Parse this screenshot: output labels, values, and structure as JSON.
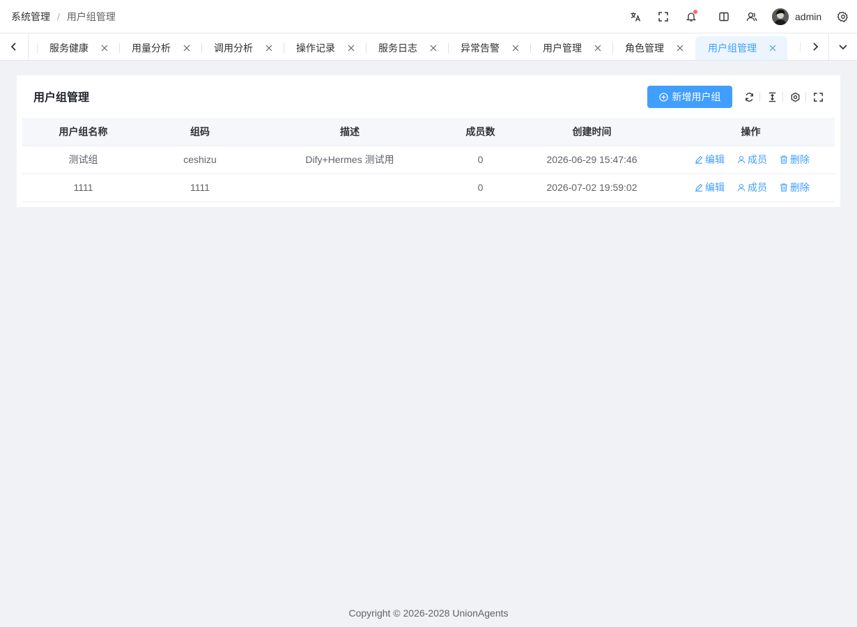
{
  "breadcrumb": {
    "parent": "系统管理",
    "separator": "/",
    "current": "用户组管理"
  },
  "header": {
    "icons": [
      "translate-icon",
      "fullscreen-icon",
      "bell-icon",
      "book-icon",
      "users-icon",
      "settings-icon"
    ],
    "notification_dot_color": "#f56c6c",
    "username": "admin"
  },
  "tabs": [
    {
      "label": "服务健康",
      "active": false
    },
    {
      "label": "用量分析",
      "active": false
    },
    {
      "label": "调用分析",
      "active": false
    },
    {
      "label": "操作记录",
      "active": false
    },
    {
      "label": "服务日志",
      "active": false
    },
    {
      "label": "异常告警",
      "active": false
    },
    {
      "label": "用户管理",
      "active": false
    },
    {
      "label": "角色管理",
      "active": false
    },
    {
      "label": "用户组管理",
      "active": true
    }
  ],
  "card": {
    "title": "用户组管理",
    "add_button": "新增用户组",
    "accent_color": "#409eff"
  },
  "table": {
    "columns": [
      "用户组名称",
      "组码",
      "描述",
      "成员数",
      "创建时间",
      "操作"
    ],
    "rows": [
      {
        "name": "测试组",
        "code": "ceshizu",
        "description": "Dify+Hermes 测试用",
        "members": "0",
        "created": "2026-06-29 15:47:46"
      },
      {
        "name": "1111",
        "code": "1111",
        "description": "",
        "members": "0",
        "created": "2026-07-02 19:59:02"
      }
    ],
    "actions": {
      "edit": "编辑",
      "members": "成员",
      "delete": "删除"
    }
  },
  "footer": "Copyright © 2026-2028 UnionAgents"
}
